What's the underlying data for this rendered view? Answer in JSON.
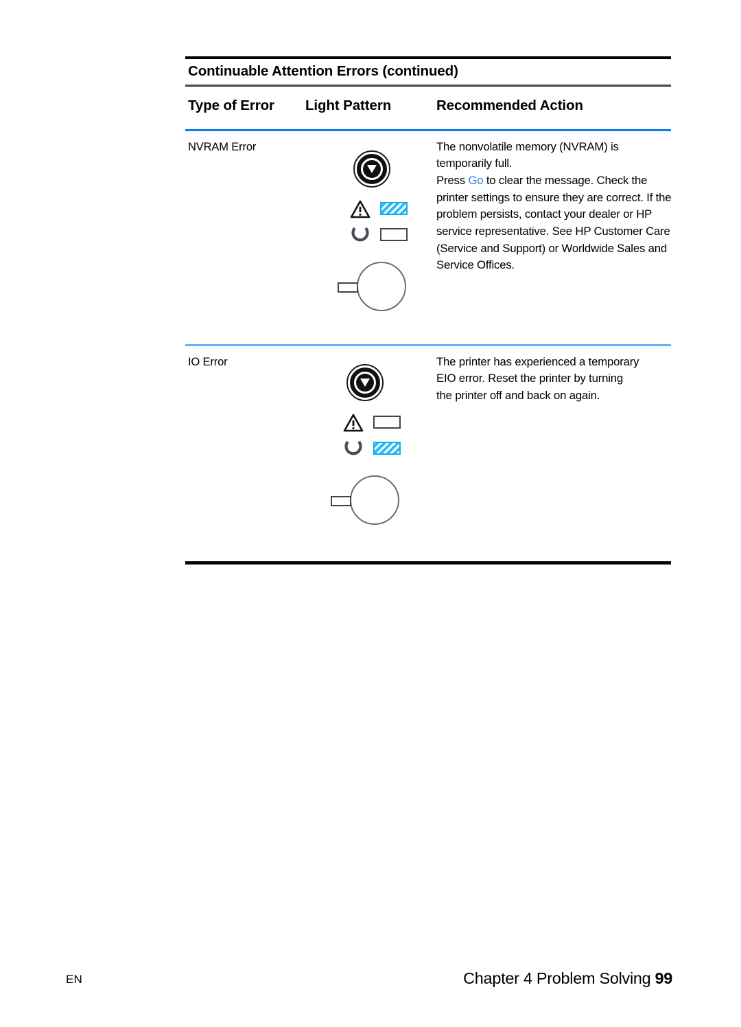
{
  "table": {
    "title": "Continuable Attention Errors (continued)",
    "columns": {
      "type": "Type of Error",
      "light": "Light Pattern",
      "action": "Recommended Action"
    },
    "rows": [
      {
        "type": "NVRAM Error",
        "action_lines": [
          "The nonvolatile memory (NVRAM) is",
          "temporarily full."
        ],
        "action_press_prefix": "Press ",
        "action_press_link": "Go",
        "action_press_rest": " to clear the message. Check the printer settings to ensure they are correct. If the problem persists, contact your dealer or HP service representative. See HP Customer Care (Service and Support) or Worldwide Sales and Service Offices.",
        "lights": {
          "go_button": "go-button-icon",
          "attention": "blinking",
          "ready": "off",
          "job_cancel": "job-cancel-button-icon"
        }
      },
      {
        "type": "IO Error",
        "action_lines": [
          "The printer has experienced a temporary",
          "EIO error. Reset the printer by turning",
          "the printer off and back on again."
        ],
        "lights": {
          "go_button": "go-button-icon",
          "attention": "off",
          "ready": "blinking",
          "job_cancel": "job-cancel-button-icon"
        }
      }
    ]
  },
  "footer": {
    "language": "EN",
    "chapter": "Chapter 4 Problem Solving",
    "page_number": "99"
  },
  "colors": {
    "rule_top": "#000000",
    "rule_gray": "#585858",
    "rule_blue_strong": "#0a7ff0",
    "rule_blue_light": "#6daefa",
    "link_blue": "#2a7fe4",
    "lamp_blink_cyan": "#29bdfb",
    "lamp_border_off": "#4a4040"
  }
}
